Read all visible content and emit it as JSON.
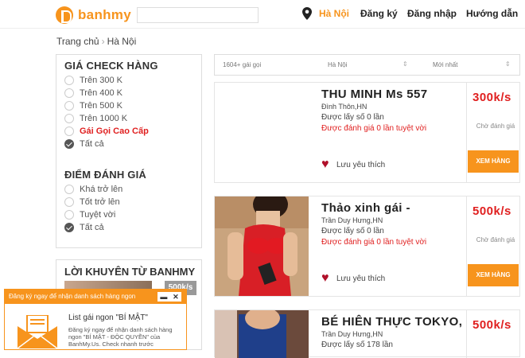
{
  "header": {
    "logo_text": "banhmy",
    "search_placeholder": "",
    "city": "Hà Nội",
    "nav": [
      "Đăng ký",
      "Đăng nhập",
      "Hướng dẫn"
    ]
  },
  "breadcrumb": {
    "home": "Trang chủ",
    "current": "Hà Nội"
  },
  "filters": {
    "price": {
      "title": "GIÁ CHECK HÀNG",
      "options": [
        "Trên 300 K",
        "Trên 400 K",
        "Trên 500 K",
        "Trên 1000 K",
        "Gái Gọi Cao Cấp",
        "Tất cả"
      ],
      "selected": "Tất cả",
      "highlighted": "Gái Gọi Cao Cấp"
    },
    "rating": {
      "title": "ĐIỂM ĐÁNH GIÁ",
      "options": [
        "Khá trở lên",
        "Tốt trở lên",
        "Tuyệt vời",
        "Tất cả"
      ],
      "selected": "Tất cả"
    }
  },
  "advice": {
    "title": "LỜI KHUYÊN TỪ BANHMY",
    "price": "500k/s"
  },
  "sortbar": {
    "count": "1604+ gái gọi",
    "city": "Hà Nội",
    "order": "Mới nhất"
  },
  "listings": [
    {
      "name": "THU MINH Ms 557",
      "location": "Đình Thôn,HN",
      "views": "Được lấy số 0 lần",
      "rated": "Được đánh giá 0 lần tuyệt vời",
      "favorite": "Lưu yêu thích",
      "price": "300k/s",
      "status": "Chờ đánh giá",
      "button": "XEM HÀNG"
    },
    {
      "name": "Thảo xinh gái -",
      "location": "Trần Duy Hưng,HN",
      "views": "Được lấy số 0 lần",
      "rated": "Được đánh giá 0 lần tuyệt vời",
      "favorite": "Lưu yêu thích",
      "price": "500k/s",
      "status": "Chờ đánh giá",
      "button": "XEM HÀNG"
    },
    {
      "name": "BÉ HIÊN THỰC TOKYO,",
      "location": "Trần Duy Hưng,HN",
      "views": "Được lấy số 178 lần",
      "price": "500k/s"
    }
  ],
  "popup": {
    "bar_text": "Đăng ký ngay để nhận danh sách hàng ngon",
    "minimize": "▬",
    "close": "✕",
    "title": "List gái ngon \"BÍ MẬT\"",
    "desc": "Đăng ký ngay để nhận danh sách hàng ngon \"BÍ MẬT - ĐỘC QUYỀN\" của BanhMy.Us. Check nhanh trước"
  },
  "colors": {
    "accent": "#f7941d",
    "red": "#e02020"
  }
}
